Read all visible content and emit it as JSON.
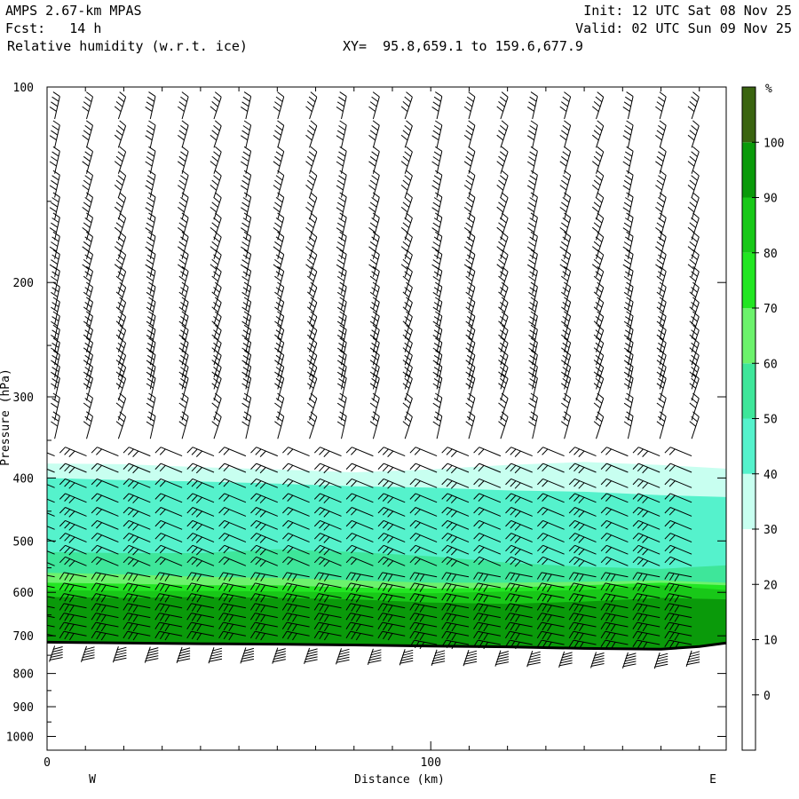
{
  "header": {
    "model": "AMPS 2.67-km MPAS",
    "fcst": "Fcst:   14 h",
    "field": "Relative humidity (w.r.t. ice)",
    "xy": "XY=  95.8,659.1 to 159.6,677.9",
    "init": "Init: 12 UTC Sat 08 Nov 25",
    "valid": "Valid: 02 UTC Sun 09 Nov 25"
  },
  "chart_data": {
    "type": "heatmap",
    "title": "Relative humidity (w.r.t. ice)",
    "xlabel": "Distance (km)",
    "ylabel": "Pressure (hPa)",
    "x_range": [
      0,
      177
    ],
    "y_range": [
      1050,
      100
    ],
    "y_scale": "log",
    "x_ticks": [
      0,
      100
    ],
    "x_end_labels": [
      "W",
      "E"
    ],
    "y_ticks": [
      100,
      200,
      300,
      400,
      500,
      600,
      700,
      800,
      900,
      1000
    ],
    "grid": false,
    "colorbar": {
      "unit": "%",
      "ticks": [
        0,
        10,
        20,
        30,
        40,
        50,
        60,
        70,
        80,
        90,
        100
      ],
      "levels": [
        30,
        40,
        50,
        60,
        70,
        80,
        90,
        100
      ],
      "colors": [
        "#c8fff0",
        "#55f2cc",
        "#3ee69a",
        "#6cf26c",
        "#22e622",
        "#18c818",
        "#0a9a0a",
        "#3a6410"
      ]
    },
    "rh_contours": [
      {
        "rh": 30,
        "pressure": [
          [
            0,
            380
          ],
          [
            20,
            381
          ],
          [
            40,
            385
          ],
          [
            60,
            388
          ],
          [
            80,
            392
          ],
          [
            100,
            388
          ],
          [
            120,
            382
          ],
          [
            140,
            378
          ],
          [
            160,
            382
          ],
          [
            177,
            387
          ]
        ]
      },
      {
        "rh": 40,
        "pressure": [
          [
            0,
            400
          ],
          [
            20,
            403
          ],
          [
            40,
            405
          ],
          [
            60,
            408
          ],
          [
            80,
            412
          ],
          [
            100,
            414
          ],
          [
            120,
            418
          ],
          [
            140,
            420
          ],
          [
            160,
            425
          ],
          [
            177,
            428
          ]
        ]
      },
      {
        "rh": 50,
        "pressure": [
          [
            0,
            520
          ],
          [
            20,
            522
          ],
          [
            40,
            522
          ],
          [
            60,
            515
          ],
          [
            80,
            520
          ],
          [
            100,
            528
          ],
          [
            120,
            540
          ],
          [
            140,
            548
          ],
          [
            160,
            552
          ],
          [
            177,
            545
          ]
        ]
      },
      {
        "rh": 60,
        "pressure": [
          [
            0,
            560
          ],
          [
            20,
            563
          ],
          [
            40,
            568
          ],
          [
            60,
            570
          ],
          [
            80,
            575
          ],
          [
            100,
            580
          ],
          [
            120,
            580
          ],
          [
            140,
            578
          ],
          [
            160,
            575
          ],
          [
            177,
            580
          ]
        ]
      },
      {
        "rh": 70,
        "pressure": [
          [
            0,
            580
          ],
          [
            20,
            582
          ],
          [
            40,
            585
          ],
          [
            60,
            585
          ],
          [
            80,
            590
          ],
          [
            100,
            592
          ],
          [
            120,
            590
          ],
          [
            140,
            585
          ],
          [
            160,
            580
          ],
          [
            177,
            585
          ]
        ]
      },
      {
        "rh": 80,
        "pressure": [
          [
            0,
            595
          ],
          [
            20,
            597
          ],
          [
            40,
            597
          ],
          [
            60,
            598
          ],
          [
            80,
            600
          ],
          [
            100,
            602
          ],
          [
            120,
            598
          ],
          [
            140,
            595
          ],
          [
            160,
            585
          ],
          [
            177,
            595
          ]
        ]
      },
      {
        "rh": 90,
        "pressure": [
          [
            0,
            610
          ],
          [
            20,
            612
          ],
          [
            40,
            610
          ],
          [
            60,
            612
          ],
          [
            80,
            615
          ],
          [
            100,
            622
          ],
          [
            120,
            625
          ],
          [
            140,
            620
          ],
          [
            160,
            612
          ],
          [
            177,
            615
          ]
        ]
      }
    ],
    "terrain_pressure": [
      [
        0,
        716
      ],
      [
        20,
        718
      ],
      [
        40,
        720
      ],
      [
        60,
        721
      ],
      [
        80,
        723
      ],
      [
        100,
        726
      ],
      [
        120,
        728
      ],
      [
        140,
        732
      ],
      [
        160,
        734
      ],
      [
        170,
        727
      ],
      [
        177,
        718
      ]
    ]
  }
}
